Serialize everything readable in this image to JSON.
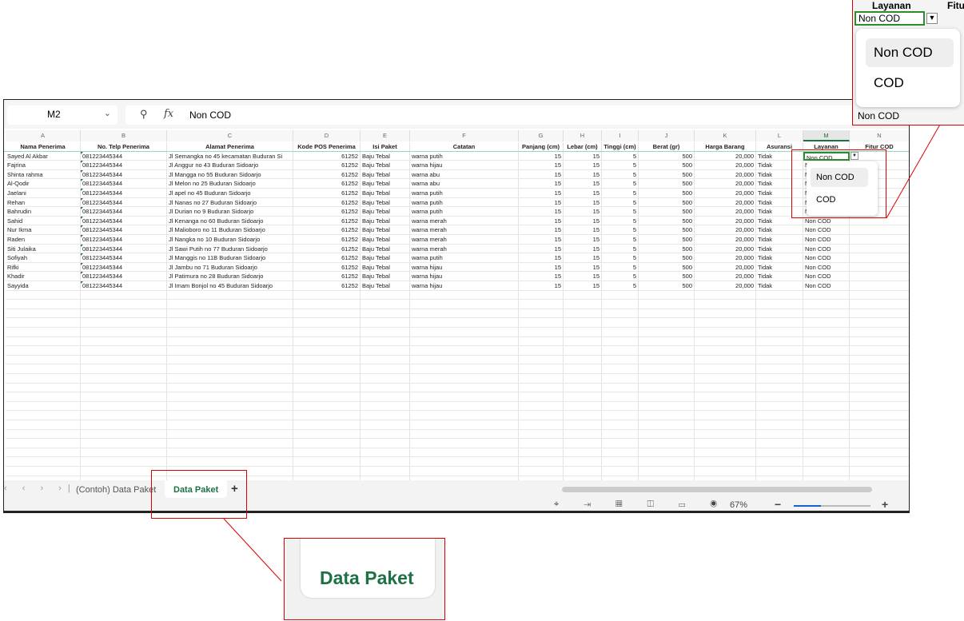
{
  "formula_bar": {
    "cell_ref": "M2",
    "formula_value": "Non COD",
    "fx_label": "fx"
  },
  "columns": [
    "A",
    "B",
    "C",
    "D",
    "E",
    "F",
    "G",
    "H",
    "I",
    "J",
    "K",
    "L",
    "M",
    "N"
  ],
  "headers": [
    "Nama Penerima",
    "No. Telp Penerima",
    "Alamat Penerima",
    "Kode POS Penerima",
    "Isi Paket",
    "Catatan",
    "Panjang (cm)",
    "Lebar (cm)",
    "Tinggi (cm)",
    "Berat (gr)",
    "Harga Barang",
    "Asuransi",
    "Layanan",
    "Fitur COD"
  ],
  "rows": [
    [
      "Sayed Al Akbar",
      "081223445344",
      "Jl Semangka no 45  kecamatan Buduran Si",
      "61252",
      "Baju Tebal",
      "warna putih",
      "15",
      "15",
      "5",
      "500",
      "20,000",
      "Tidak",
      "Non COD",
      ""
    ],
    [
      "Fajrina",
      "081223445344",
      "Jl Anggur no 43 Buduran Sidoarjo",
      "61252",
      "Baju Tebal",
      "warna hijau",
      "15",
      "15",
      "5",
      "500",
      "20,000",
      "Tidak",
      "Non COD",
      ""
    ],
    [
      "Shinta rahma",
      "081223445344",
      "Jl Mangga no 55 Buduran Sidoarjo",
      "61252",
      "Baju Tebal",
      "warna abu",
      "15",
      "15",
      "5",
      "500",
      "20,000",
      "Tidak",
      "Non COD",
      ""
    ],
    [
      "Al-Qodir",
      "081223445344",
      "Jl Melon no 25 Buduran Sidoarjo",
      "61252",
      "Baju Tebal",
      "warna abu",
      "15",
      "15",
      "5",
      "500",
      "20,000",
      "Tidak",
      "Non COD",
      ""
    ],
    [
      "Jaelani",
      "081223445344",
      "Jl apel no 45 Buduran Sidoarjo",
      "61252",
      "Baju Tebal",
      "warna putih",
      "15",
      "15",
      "5",
      "500",
      "20,000",
      "Tidak",
      "Non COD",
      ""
    ],
    [
      "Rehan",
      "081223445344",
      "Jl Nanas no 27 Buduran Sidoarjo",
      "61252",
      "Baju Tebal",
      "warna putih",
      "15",
      "15",
      "5",
      "500",
      "20,000",
      "Tidak",
      "Non COD",
      ""
    ],
    [
      "Bahrudin",
      "081223445344",
      "Jl Durian no 9 Buduran Sidoarjo",
      "61252",
      "Baju Tebal",
      "warna putih",
      "15",
      "15",
      "5",
      "500",
      "20,000",
      "Tidak",
      "Non COD",
      ""
    ],
    [
      "Sahid",
      "081223445344",
      "Jl Kenanga no 60 Buduran Sidoarjo",
      "61252",
      "Baju Tebal",
      "warna merah",
      "15",
      "15",
      "5",
      "500",
      "20,000",
      "Tidak",
      "Non COD",
      ""
    ],
    [
      "Nur Ikma",
      "081223445344",
      "Jl Malioboro no 11 Buduran Sidoarjo",
      "61252",
      "Baju Tebal",
      "warna merah",
      "15",
      "15",
      "5",
      "500",
      "20,000",
      "Tidak",
      "Non COD",
      ""
    ],
    [
      "Raden",
      "081223445344",
      "Jl Nangka no 10 Buduran Sidoarjo",
      "61252",
      "Baju Tebal",
      "warna merah",
      "15",
      "15",
      "5",
      "500",
      "20,000",
      "Tidak",
      "Non COD",
      ""
    ],
    [
      "Siti Julaika",
      "081223445344",
      "Jl Sawi Putih no 77 Buduran Sidoarjo",
      "61252",
      "Baju Tebal",
      "warna merah",
      "15",
      "15",
      "5",
      "500",
      "20,000",
      "Tidak",
      "Non COD",
      ""
    ],
    [
      "Sofiyah",
      "081223445344",
      "Jl Manggis no 11B Buduran Sidoarjo",
      "61252",
      "Baju Tebal",
      "warna putih",
      "15",
      "15",
      "5",
      "500",
      "20,000",
      "Tidak",
      "Non COD",
      ""
    ],
    [
      "Rifki",
      "081223445344",
      "Jl Jambu no 71 Buduran Sidoarjo",
      "61252",
      "Baju Tebal",
      "warna hijau",
      "15",
      "15",
      "5",
      "500",
      "20,000",
      "Tidak",
      "Non COD",
      ""
    ],
    [
      "Khadir",
      "081223445344",
      "Jl Patimura no 28 Buduran Sidoarjo",
      "61252",
      "Baju Tebal",
      "warna hijau",
      "15",
      "15",
      "5",
      "500",
      "20,000",
      "Tidak",
      "Non COD",
      ""
    ],
    [
      "Sayyida",
      "081223445344",
      "Jl Imam Bonjol no 45 Buduran Sidoarjo",
      "61252",
      "Baju Tebal",
      "warna hijau",
      "15",
      "15",
      "5",
      "500",
      "20,000",
      "Tidak",
      "Non COD",
      ""
    ]
  ],
  "dropdown": {
    "options": [
      "Non COD",
      "COD"
    ],
    "highlighted": "Non COD"
  },
  "sheet_tabs": [
    {
      "label": "(Contoh) Data Paket",
      "active": false
    },
    {
      "label": "Data Paket",
      "active": true
    }
  ],
  "add_sheet": "+",
  "status_bar": {
    "zoom": "67%",
    "zoom_level_percent": 67
  },
  "inset_top": {
    "header": "Layanan",
    "header_next": "Fitu",
    "cell": "Non COD",
    "below": "Non COD"
  },
  "inset_bottom": {
    "tab": "Data Paket"
  },
  "colors": {
    "accent": "#1e7145",
    "annotation": "#dd0000"
  }
}
